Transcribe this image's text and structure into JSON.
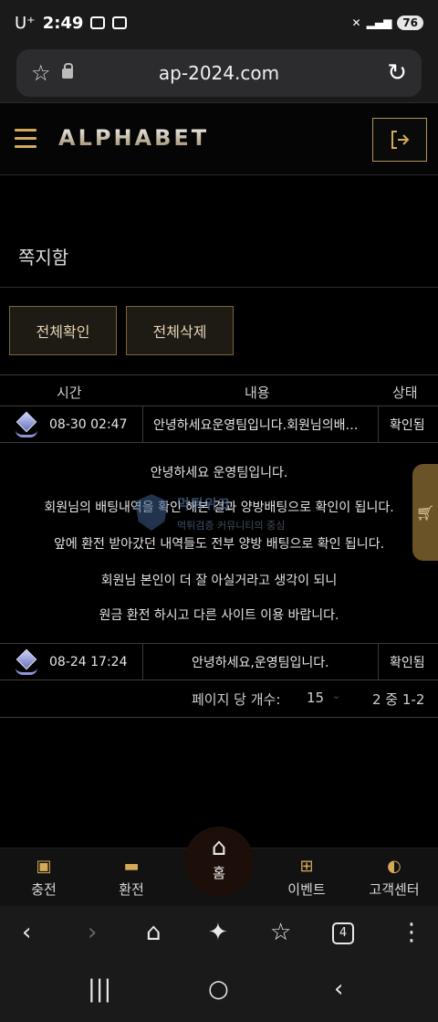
{
  "status_bar": {
    "carrier": "U⁺",
    "time": "2:49",
    "battery": "76"
  },
  "browser": {
    "url": "ap-2024.com",
    "tabs_count": "4"
  },
  "header": {
    "logo": "ALPHABET"
  },
  "page": {
    "title": "쪽지함"
  },
  "actions": {
    "confirm_all": "전체확인",
    "delete_all": "전체삭제"
  },
  "table": {
    "columns": [
      "시간",
      "내용",
      "상태"
    ],
    "rows": [
      {
        "time": "08-30 02:47",
        "subject": "안녕하세요운영팀입니다.회원님의배…",
        "status": "확인됨"
      },
      {
        "time": "08-24 17:24",
        "subject": "안녕하세요,운영팀입니다.",
        "status": "확인됨"
      }
    ],
    "expanded_body": [
      "안녕하세요 운영팀입니다.",
      "회원님의 배팅내역을 확인 해본 결과 양방배팅으로 확인이 됩니다.",
      "앞에 환전 받아갔던 내역들도 전부 양방 배팅으로 확인 됩니다.",
      "회원님 본인이 더 잘 아실거라고 생각이 되니",
      "원금 환전 하시고 다른 사이트 이용 바랍니다."
    ]
  },
  "watermark": {
    "title": "먹튀위크",
    "sub_highlight": "먹튀검증",
    "sub_rest": " 커뮤니티의 중심"
  },
  "pagination": {
    "per_page_label": "페이지 당 개수:",
    "per_page_value": "15",
    "range": "2 중 1-2"
  },
  "bottom_nav": {
    "charge": "충전",
    "withdraw": "환전",
    "home": "홈",
    "event": "이벤트",
    "support": "고객센터"
  },
  "colors": {
    "accent_gold": "#d4a957",
    "background": "#000000",
    "border": "#3a3a3a"
  }
}
